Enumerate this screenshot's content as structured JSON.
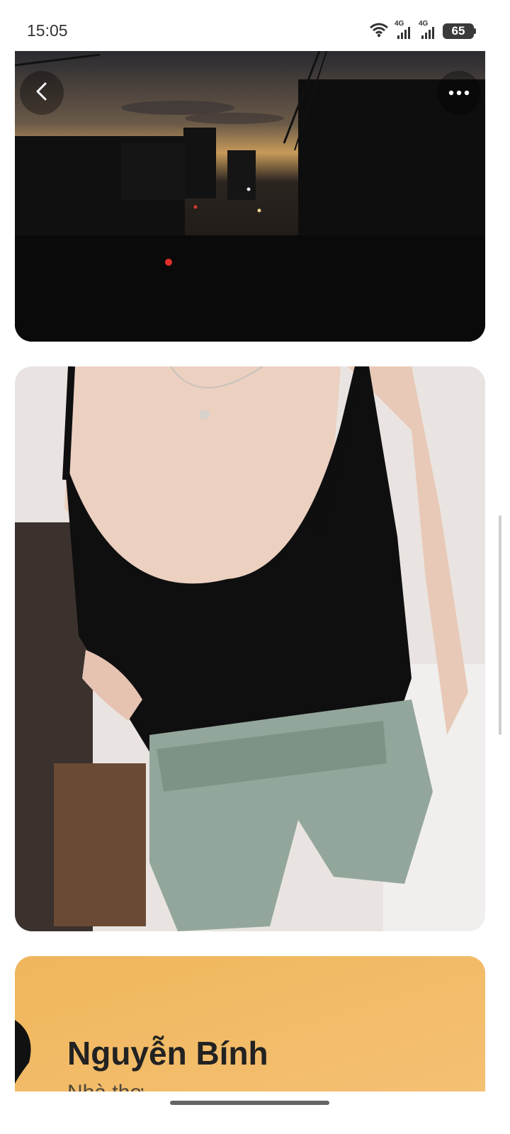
{
  "status_bar": {
    "time": "15:05",
    "battery": "65",
    "network_1": "4G",
    "network_2": "4G",
    "icons": [
      "wifi-icon",
      "signal-4g-icon",
      "signal-4g-icon",
      "battery-icon"
    ]
  },
  "viewer": {
    "back_icon": "chevron-left-icon",
    "more_icon": "more-horizontal-icon",
    "photos": [
      {
        "name": "dusk street scene"
      },
      {
        "name": "selfie photo"
      },
      {
        "name": "text card photo"
      }
    ],
    "card_text": {
      "title": "Nguyễn Bính",
      "subtitle": "Nhà thơ"
    }
  },
  "colors": {
    "background": "#ffffff",
    "card_bg": "#f2b85e",
    "overlay": "#00000059"
  }
}
